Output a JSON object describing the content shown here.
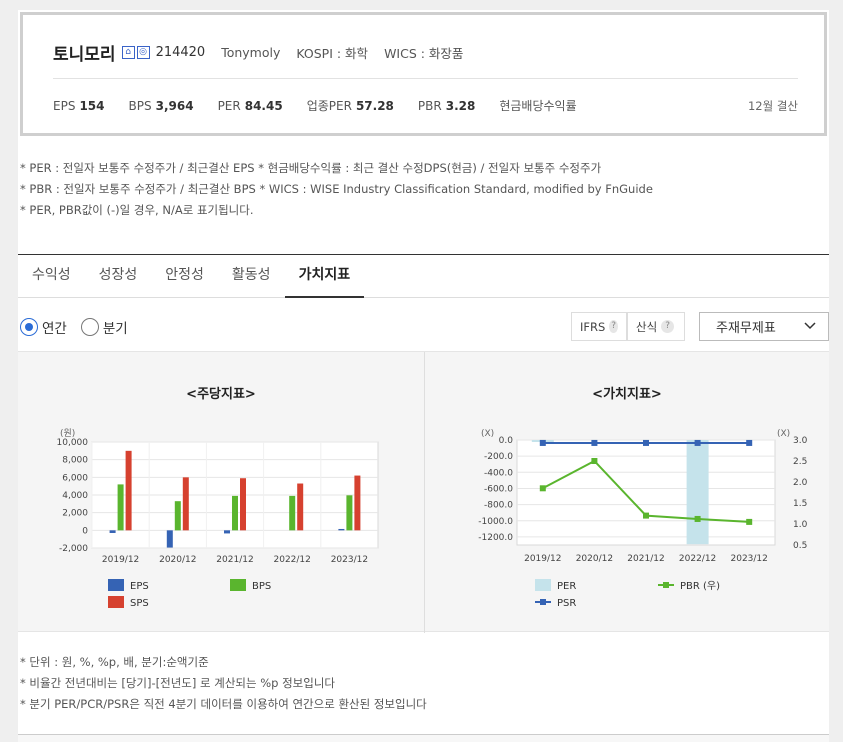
{
  "header": {
    "name": "토니모리",
    "icons": [
      "home-icon",
      "ir-icon"
    ],
    "code": "214420",
    "english_name": "Tonymoly",
    "market": "KOSPI : 화학",
    "wics": "WICS : 화장품"
  },
  "metrics": {
    "eps_label": "EPS",
    "eps_value": "154",
    "bps_label": "BPS",
    "bps_value": "3,964",
    "per_label": "PER",
    "per_value": "84.45",
    "sector_per_label": "업종PER",
    "sector_per_value": "57.28",
    "pbr_label": "PBR",
    "pbr_value": "3.28",
    "dividend_label": "현금배당수익률",
    "settlement": "12월 결산"
  },
  "notes": [
    "* PER : 전일자 보통주 수정주가 / 최근결산 EPS * 현금배당수익률 : 최근 결산 수정DPS(현금) / 전일자 보통주 수정주가",
    "* PBR : 전일자 보통주 수정주가 / 최근결산 BPS * WICS : WISE Industry Classification Standard, modified by FnGuide",
    "* PER, PBR값이 (-)일 경우, N/A로 표기됩니다."
  ],
  "tabs": [
    "수익성",
    "성장성",
    "안정성",
    "활동성",
    "가치지표"
  ],
  "active_tab": "가치지표",
  "period": {
    "annual": "연간",
    "quarter": "분기"
  },
  "options": {
    "ifrs": "IFRS",
    "calc": "산식",
    "help": "?"
  },
  "select": {
    "value": "주재무제표"
  },
  "chart_data": [
    {
      "type": "bar",
      "title": "<주당지표>",
      "unit_label": "(원)",
      "categories": [
        "2019/12",
        "2020/12",
        "2021/12",
        "2022/12",
        "2023/12"
      ],
      "series": [
        {
          "name": "EPS",
          "color": "#3563b4",
          "values": [
            -300,
            -1950,
            -350,
            0,
            154
          ]
        },
        {
          "name": "BPS",
          "color": "#5ab52e",
          "values": [
            5200,
            3300,
            3900,
            3900,
            3964
          ]
        },
        {
          "name": "SPS",
          "color": "#d6412f",
          "values": [
            9000,
            6000,
            5900,
            5300,
            6200
          ]
        }
      ],
      "ylim": [
        -2000,
        10000
      ],
      "yticks": [
        "10,000",
        "8,000",
        "6,000",
        "4,000",
        "2,000",
        "0",
        "-2,000"
      ],
      "grid": true,
      "legend": "bottom"
    },
    {
      "type": "bar+line",
      "title": "<가치지표>",
      "left_unit_label": "(X)",
      "right_unit_label": "(X)",
      "categories": [
        "2019/12",
        "2020/12",
        "2021/12",
        "2022/12",
        "2023/12"
      ],
      "left_axis": {
        "ylim": [
          -1300,
          0
        ],
        "ticks": [
          "0.0",
          "-200.0",
          "-400.0",
          "-600.0",
          "-800.0",
          "-1000.0",
          "-1200.0"
        ]
      },
      "right_axis": {
        "ylim": [
          0.5,
          3.0
        ],
        "ticks": [
          "3.0",
          "2.5",
          "2.0",
          "1.5",
          "1.0",
          "0.5"
        ]
      },
      "series": [
        {
          "name": "PER",
          "kind": "bar",
          "axis": "left",
          "color": "#c5e3eb",
          "values": [
            -20,
            0,
            0,
            -1290,
            0
          ]
        },
        {
          "name": "PBR (우)",
          "kind": "line",
          "axis": "right",
          "color": "#5ab52e",
          "values": [
            1.85,
            2.5,
            1.2,
            1.12,
            1.05
          ]
        },
        {
          "name": "PSR",
          "kind": "line",
          "axis": "right",
          "color": "#3563b4",
          "values": [
            2.93,
            2.93,
            2.93,
            2.93,
            2.93
          ]
        }
      ],
      "grid": true,
      "legend": "bottom"
    }
  ],
  "footnotes": [
    "* 단위 : 원, %, %p, 배, 분기:순액기준",
    "* 비율간 전년대비는 [당기]-[전년도] 로 계산되는 %p 정보입니다",
    "* 분기 PER/PCR/PSR은 직전 4분기 데이터를 이용하여 연간으로 환산된 정보입니다"
  ]
}
